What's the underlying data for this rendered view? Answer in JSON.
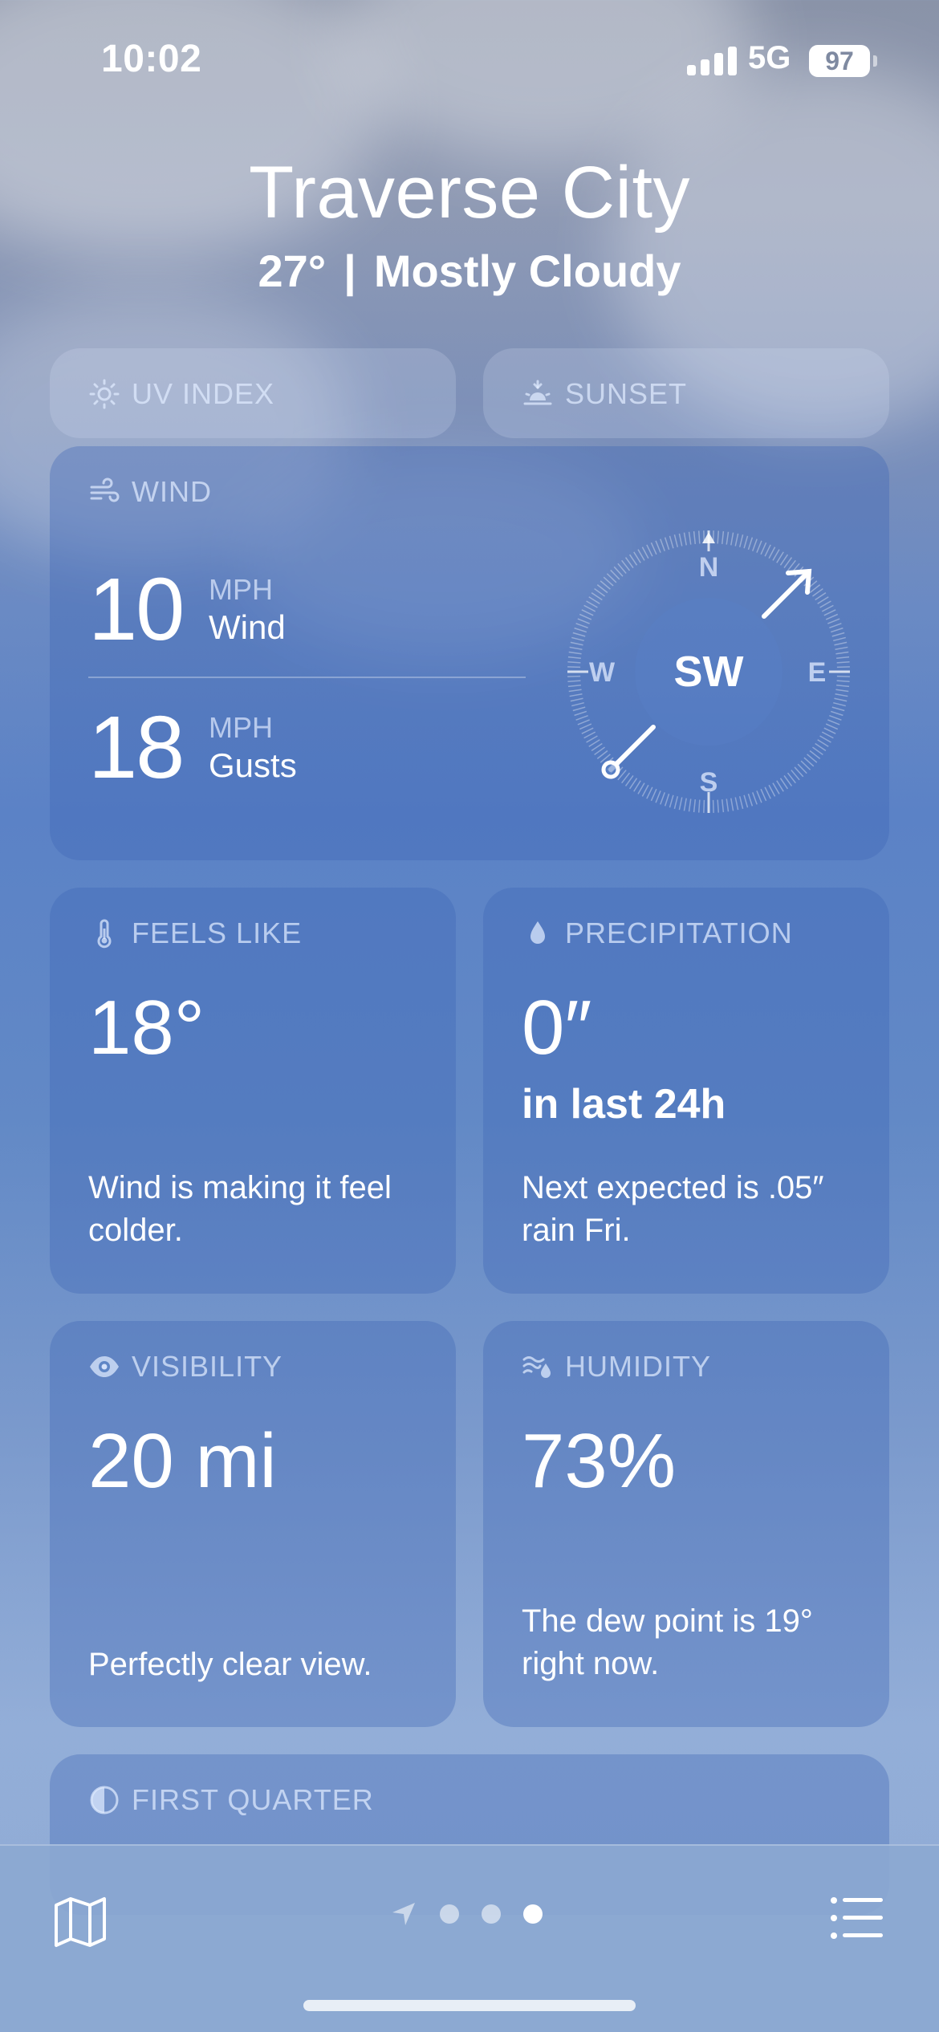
{
  "status_bar": {
    "time": "10:02",
    "network": "5G",
    "battery": "97"
  },
  "header": {
    "city": "Traverse City",
    "temperature": "27°",
    "separator": "|",
    "condition": "Mostly Cloudy"
  },
  "tiles": {
    "uv_index": {
      "title": "UV INDEX",
      "icon": "sun-icon"
    },
    "sunset": {
      "title": "SUNSET",
      "icon": "sunset-icon"
    },
    "wind": {
      "title": "WIND",
      "icon": "wind-icon",
      "speed": "10",
      "speed_unit": "MPH",
      "speed_label": "Wind",
      "gusts": "18",
      "gusts_unit": "MPH",
      "gusts_label": "Gusts",
      "direction": "SW",
      "compass": {
        "n": "N",
        "e": "E",
        "s": "S",
        "w": "W"
      }
    },
    "feels_like": {
      "title": "FEELS LIKE",
      "icon": "thermometer-icon",
      "value": "18°",
      "description": "Wind is making it feel colder."
    },
    "precipitation": {
      "title": "PRECIPITATION",
      "icon": "raindrop-icon",
      "value": "0″",
      "period": "in last 24h",
      "description": "Next expected is .05″ rain Fri."
    },
    "visibility": {
      "title": "VISIBILITY",
      "icon": "eye-icon",
      "value": "20 mi",
      "description": "Perfectly clear view."
    },
    "humidity": {
      "title": "HUMIDITY",
      "icon": "humidity-icon",
      "value": "73%",
      "description": "The dew point is 19° right now."
    },
    "moon": {
      "title": "FIRST QUARTER",
      "icon": "moon-phase-icon"
    }
  },
  "bottom_bar": {
    "icons": [
      "map-icon",
      "location-arrow-icon",
      "list-icon"
    ],
    "page_count": 3,
    "active_page": 3
  },
  "colors": {
    "accent": "#5b82c6",
    "text": "#ffffff",
    "muted": "#e1ebff"
  }
}
